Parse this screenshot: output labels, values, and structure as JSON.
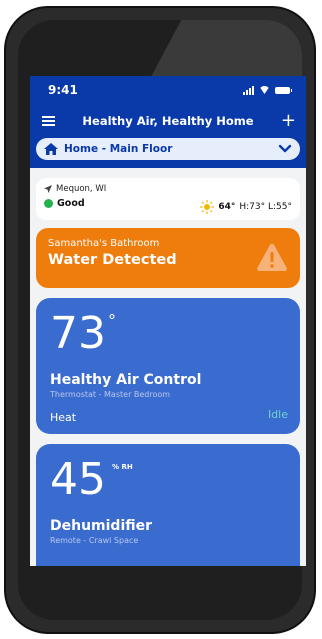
{
  "status_bar": {
    "time": "9:41"
  },
  "app_bar": {
    "title": "Healthy Air, Healthy Home"
  },
  "location_selector": {
    "label": "Home - Main Floor"
  },
  "weather": {
    "city": "Mequon, WI",
    "air_quality": "Good",
    "current_temp": "64°",
    "high_low": "H:73° L:55°"
  },
  "alert": {
    "room": "Samantha's Bathroom",
    "message": "Water Detected"
  },
  "cards": [
    {
      "value": "73",
      "unit": "°",
      "title": "Healthy Air Control",
      "subtitle": "Thermostat - Master Bedroom",
      "mode": "Heat",
      "state": "Idle"
    },
    {
      "value": "45",
      "unit": "% RH",
      "title": "Dehumidifier",
      "subtitle": "Remote - Crawl Space"
    }
  ],
  "colors": {
    "primary": "#0a3aa9",
    "alert": "#ee7d0e",
    "card": "#3a6bcf",
    "good": "#22b14c",
    "idle": "#6fd3cc"
  }
}
